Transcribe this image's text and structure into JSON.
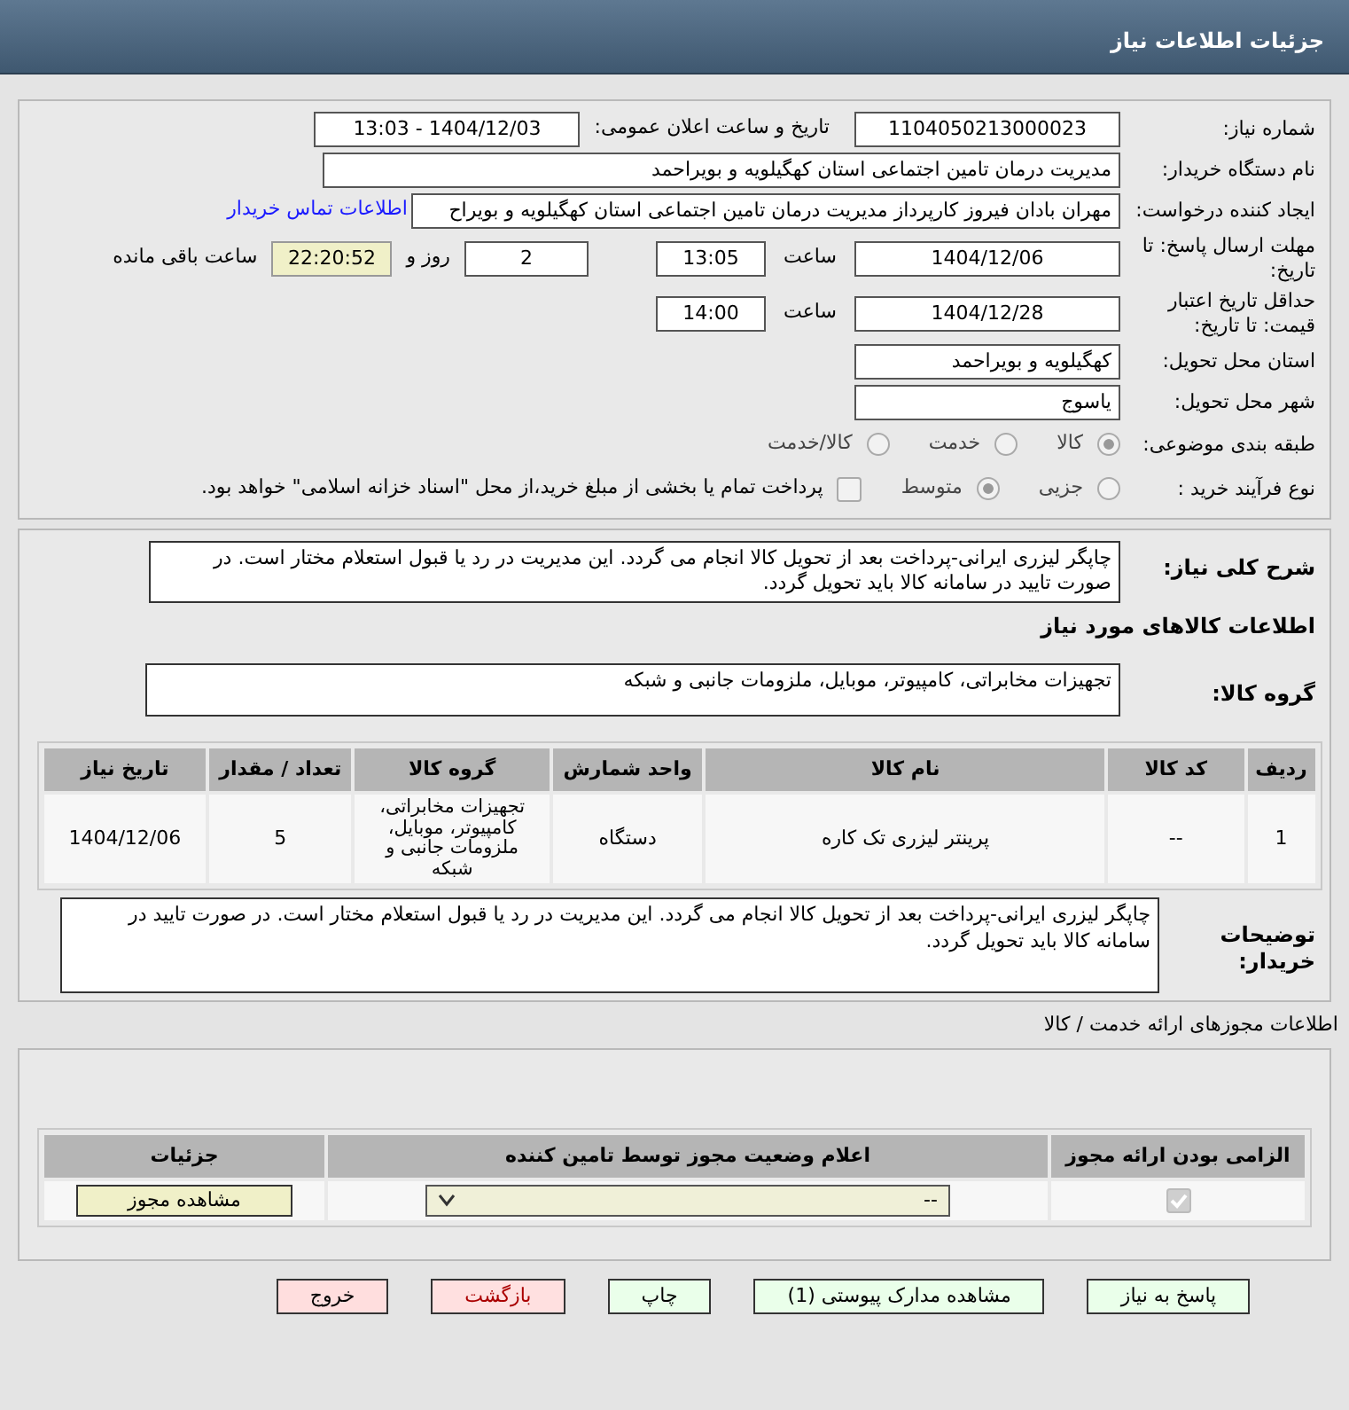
{
  "header": {
    "title": "جزئیات اطلاعات نیاز"
  },
  "need_number": {
    "label": "شماره نیاز:",
    "value": "1104050213000023"
  },
  "announce": {
    "label": "تاریخ و ساعت اعلان عمومی:",
    "value": "1404/12/03 - 13:03"
  },
  "buyer_org": {
    "label": "نام دستگاه خریدار:",
    "value": "مدیریت درمان تامین اجتماعی استان کهگیلویه و بویراحمد"
  },
  "creator": {
    "label": "ایجاد کننده درخواست:",
    "value": "مهران بادان فیروز کارپرداز مدیریت درمان تامین اجتماعی استان کهگیلویه و بویراح",
    "contact_link": "اطلاعات تماس خریدار"
  },
  "deadline": {
    "label": "مهلت ارسال پاسخ: تا تاریخ:",
    "date": "1404/12/06",
    "time_label": "ساعت",
    "time": "13:05",
    "days": "2",
    "days_label": "روز و",
    "remaining": "22:20:52",
    "remaining_label": "ساعت باقی مانده"
  },
  "validity": {
    "label": "حداقل تاریخ اعتبار قیمت: تا تاریخ:",
    "date": "1404/12/28",
    "time_label": "ساعت",
    "time": "14:00"
  },
  "province": {
    "label": "استان محل تحویل:",
    "value": "کهگیلویه و بویراحمد"
  },
  "city": {
    "label": "شهر محل تحویل:",
    "value": "یاسوج"
  },
  "category": {
    "label": "طبقه بندی موضوعی:",
    "options": [
      {
        "label": "کالا",
        "selected": true
      },
      {
        "label": "خدمت",
        "selected": false
      },
      {
        "label": "کالا/خدمت",
        "selected": false
      }
    ]
  },
  "purchase_type": {
    "label": "نوع فرآیند خرید :",
    "options": [
      {
        "label": "جزیی",
        "selected": false
      },
      {
        "label": "متوسط",
        "selected": true
      }
    ],
    "treasury": {
      "label": "پرداخت تمام یا بخشی از مبلغ خرید،از محل \"اسناد خزانه اسلامی\" خواهد بود.",
      "checked": false
    }
  },
  "description": {
    "label": "شرح کلی نیاز:",
    "value": "چاپگر لیزری ایرانی-پرداخت بعد از تحویل کالا انجام می گردد. این مدیریت در رد یا قبول استعلام مختار است. در صورت تایید در سامانه کالا باید تحویل گردد."
  },
  "goods_title": "اطلاعات کالاهای مورد نیاز",
  "goods_group": {
    "label": "گروه کالا:",
    "value": "تجهیزات مخابراتی، کامپیوتر، موبایل، ملزومات جانبی و شبکه"
  },
  "goods_table": {
    "columns": [
      "ردیف",
      "کد کالا",
      "نام کالا",
      "واحد شمارش",
      "گروه کالا",
      "تعداد / مقدار",
      "تاریخ نیاز"
    ],
    "rows": [
      [
        "1",
        "--",
        "پرینتر لیزری تک کاره",
        "دستگاه",
        "تجهیزات مخابراتی، کامپیوتر، موبایل، ملزومات جانبی و شبکه",
        "5",
        "1404/12/06"
      ]
    ]
  },
  "buyer_notes": {
    "label": "توضیحات خریدار:",
    "value": "چاپگر لیزری ایرانی-پرداخت بعد از تحویل کالا انجام می گردد. این مدیریت در رد یا قبول استعلام مختار است. در صورت تایید در سامانه کالا باید تحویل گردد."
  },
  "license_title": "اطلاعات مجوزهای ارائه خدمت / کالا",
  "license_table": {
    "columns": [
      "الزامی بودن ارائه مجوز",
      "اعلام وضعیت مجوز توسط تامین کننده",
      "جزئیات"
    ],
    "rows": [
      {
        "required": true,
        "disabled": true,
        "status": "--",
        "details_button": "مشاهده مجوز"
      }
    ]
  },
  "buttons": [
    {
      "label": "پاسخ به نیاز",
      "kind": "action"
    },
    {
      "label": "مشاهده مدارک پیوستی (1)",
      "kind": "action"
    },
    {
      "label": "چاپ",
      "kind": "action"
    },
    {
      "label": "بازگشت",
      "kind": "back"
    },
    {
      "label": "خروج",
      "kind": "exit"
    }
  ]
}
